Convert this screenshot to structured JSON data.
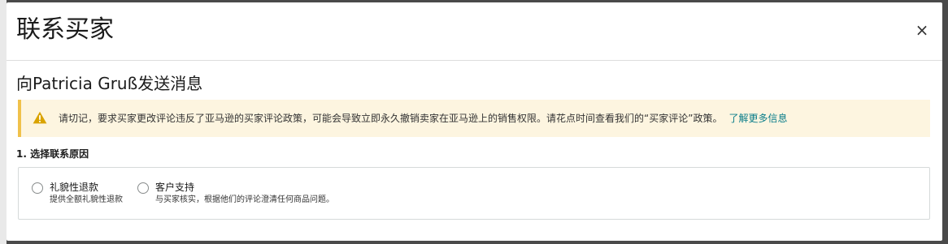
{
  "modal": {
    "title": "联系买家",
    "close_label": "×"
  },
  "section": {
    "title": "向Patricia Gruß发送消息"
  },
  "alert": {
    "text": "请切记，要求买家更改评论违反了亚马逊的买家评论政策，可能会导致立即永久撤销卖家在亚马逊上的销售权限。请花点时间查看我们的“买家评论”政策。",
    "link_label": "了解更多信息",
    "icon": "warning-icon",
    "accent_color": "#f0c14b",
    "link_color": "#0b7e8a"
  },
  "reason": {
    "step_label": "1. 选择联系原因",
    "options": [
      {
        "label": "礼貌性退款",
        "description": "提供全额礼貌性退款",
        "selected": false
      },
      {
        "label": "客户支持",
        "description": "与买家核实，根据他们的评论澄清任何商品问题。",
        "selected": false
      }
    ]
  }
}
